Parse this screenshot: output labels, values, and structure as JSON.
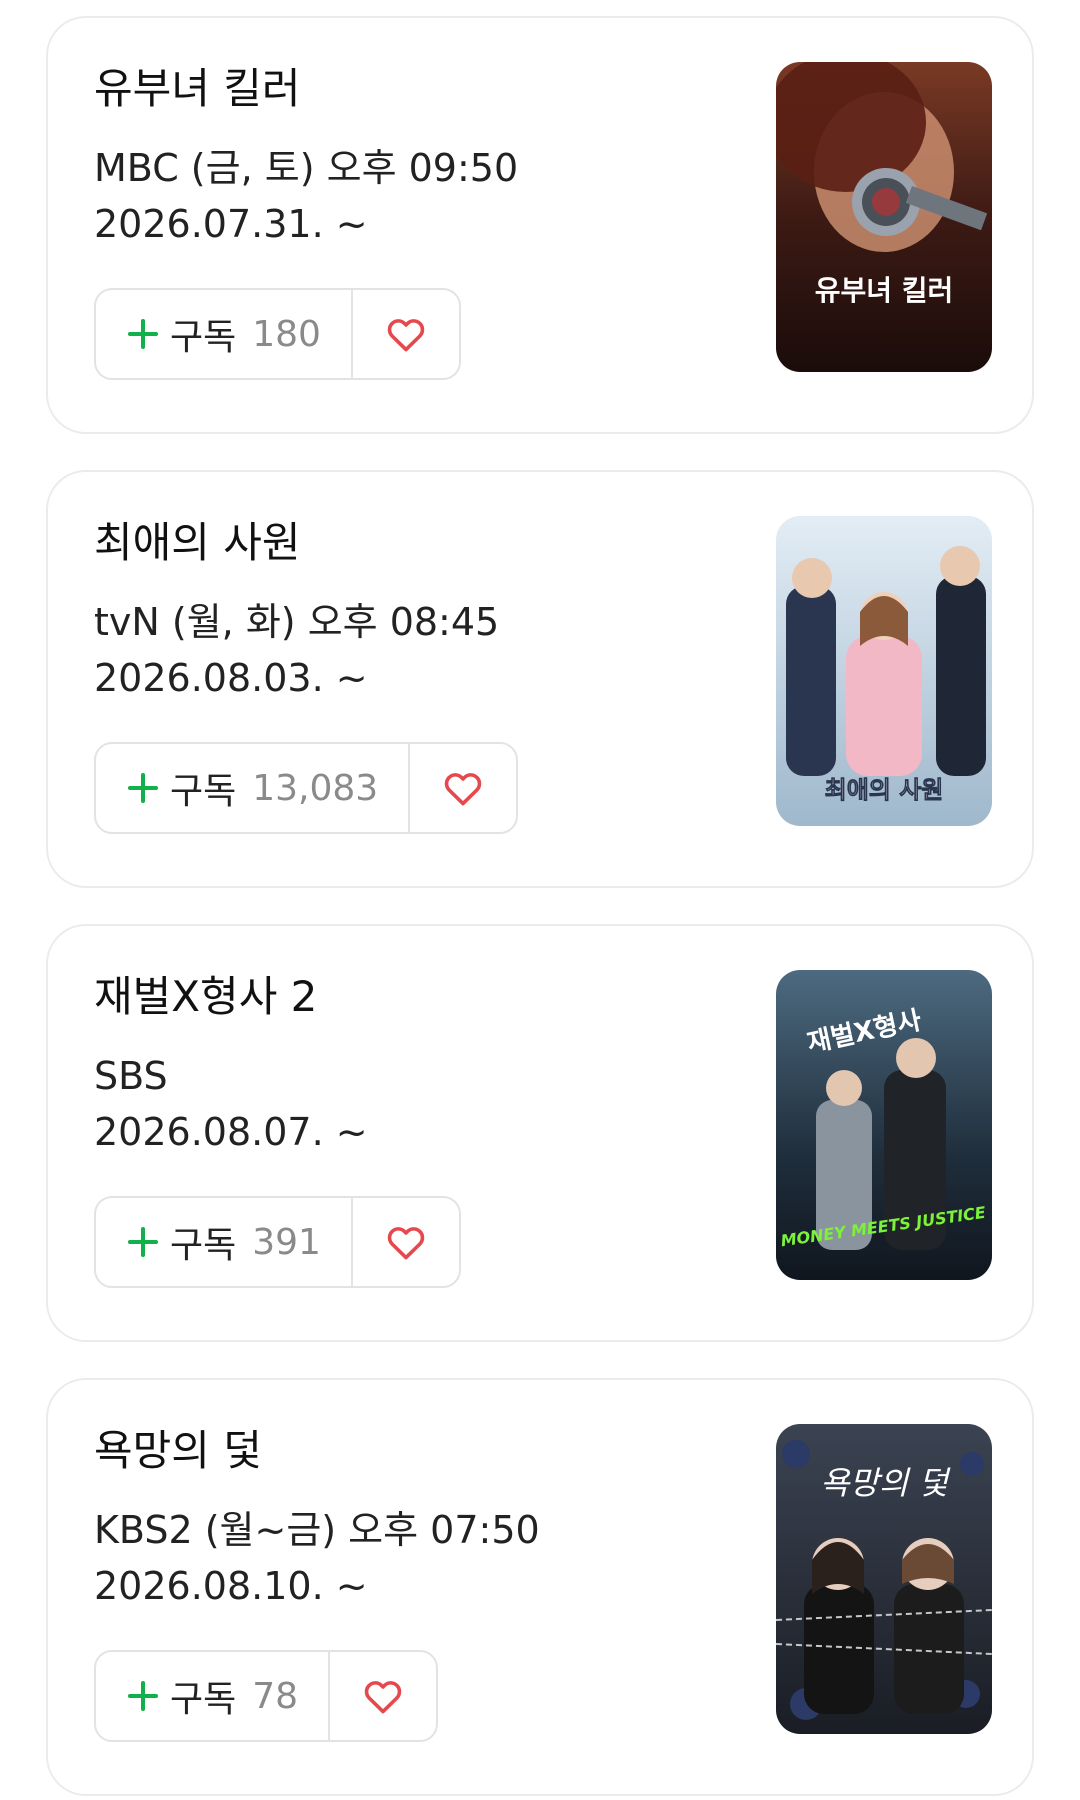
{
  "colors": {
    "accent_green": "#12b04a",
    "heart_red": "#e5484d",
    "count_gray": "#8a8a8a"
  },
  "subscribe_label": "구독",
  "icons": {
    "plus": "plus-icon",
    "like": "heart-icon"
  },
  "shows": [
    {
      "title": "유부녀 킬러",
      "schedule": "MBC (금, 토) 오후 09:50",
      "date": "2026.07.31. ~",
      "subscribers": "180",
      "poster": {
        "alt": "유부녀 킬러 poster",
        "text": "유부녀 킬러",
        "bg": "#4a1f1a"
      }
    },
    {
      "title": "최애의 사원",
      "schedule": "tvN (월, 화) 오후 08:45",
      "date": "2026.08.03. ~",
      "subscribers": "13,083",
      "poster": {
        "alt": "최애의 사원 poster",
        "text": "최애의 사원",
        "bg": "#cfe0ec"
      }
    },
    {
      "title": "재벌X형사 2",
      "schedule": "SBS",
      "date": "2026.08.07. ~",
      "subscribers": "391",
      "poster": {
        "alt": "재벌X형사 2 poster",
        "text": "재벌X형사",
        "subtext": "MONEY MEETS JUSTICE",
        "bg": "#1e2a36"
      }
    },
    {
      "title": "욕망의 덫",
      "schedule": "KBS2 (월~금) 오후 07:50",
      "date": "2026.08.10. ~",
      "subscribers": "78",
      "poster": {
        "alt": "욕망의 덫 poster",
        "text": "욕망의 덫",
        "bg": "#2a2f3a"
      }
    }
  ]
}
